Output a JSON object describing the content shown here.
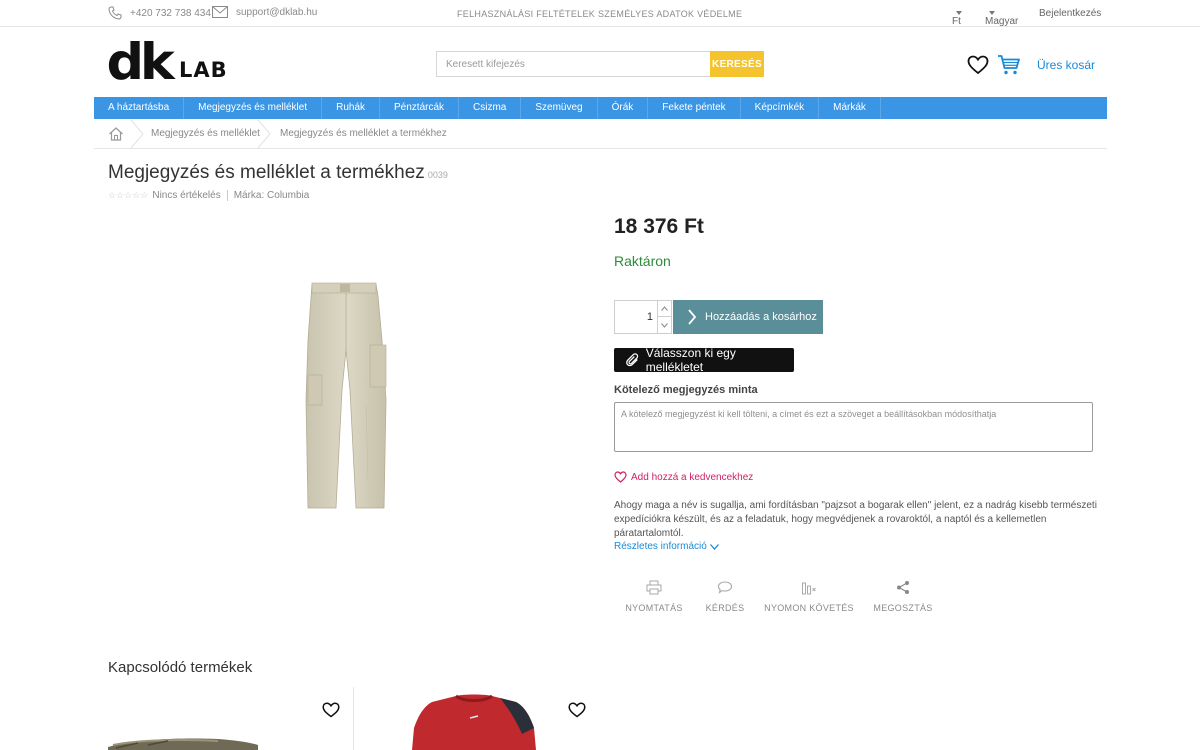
{
  "topbar": {
    "phone": "+420 732 738 434",
    "email": "support@dklab.hu",
    "links": [
      "FELHASZNÁLÁSI FELTÉTELEK",
      "SZEMÉLYES ADATOK VÉDELME"
    ],
    "currency": "Ft",
    "language": "Magyar",
    "login": "Bejelentkezés"
  },
  "header": {
    "logo_main": "dk",
    "logo_sub": "LAB",
    "search_placeholder": "Keresett kifejezés",
    "search_button": "KERESÉS",
    "cart_label": "Üres kosár"
  },
  "nav": {
    "items": [
      "A háztartásba",
      "Megjegyzés és melléklet",
      "Ruhák",
      "Pénztárcák",
      "Csizma",
      "Szemüveg",
      "Órák",
      "Fekete péntek",
      "Képcímkék",
      "Márkák"
    ]
  },
  "breadcrumb": {
    "items": [
      "Megjegyzés és melléklet",
      "Megjegyzés és melléklet a termékhez"
    ]
  },
  "product": {
    "title": "Megjegyzés és melléklet a termékhez",
    "code": "0039",
    "rating_text": "Nincs értékelés",
    "brand": "Márka: Columbia",
    "price": "18 376 Ft",
    "stock": "Raktáron",
    "quantity": "1",
    "add_to_cart": "Hozzáadás a kosárhoz",
    "attach_button": "Válasszon ki egy mellékletet",
    "note_label": "Kötelező megjegyzés minta",
    "note_placeholder": "A kötelező megjegyzést ki kell tölteni, a címet és ezt a szöveget a beállításokban módosíthatja",
    "favorite": "Add hozzá a kedvencekhez",
    "description": "Ahogy maga a név is sugallja, ami fordításban \"pajzsot a bogarak ellen\" jelent, ez a nadrág kisebb természeti expedíciókra készült, és az a feladatuk, hogy megvédjenek a rovaroktól, a naptól és a kellemetlen páratartalomtól.",
    "more_info": "Részletes információ",
    "actions": [
      "NYOMTATÁS",
      "KÉRDÉS",
      "NYOMON KÖVETÉS",
      "MEGOSZTÁS"
    ]
  },
  "related": {
    "title": "Kapcsolódó termékek"
  },
  "colors": {
    "nav_blue": "#3b95e5",
    "search_yellow": "#f4c32d",
    "add_to_cart": "#5a8f9a",
    "stock_green": "#2e8a3a",
    "favorite_pink": "#d01f62",
    "link_blue": "#1a8ad8"
  }
}
